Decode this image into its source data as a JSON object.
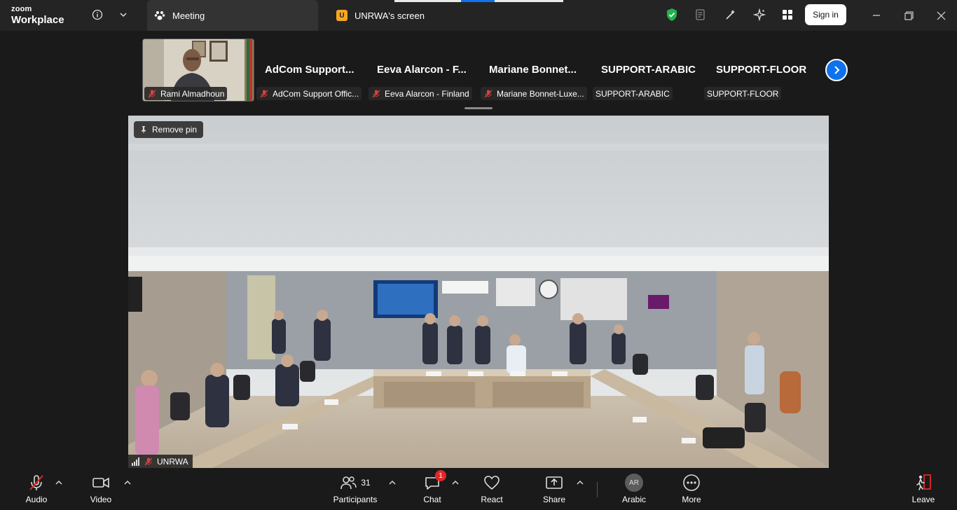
{
  "app": {
    "logo_line1": "zoom",
    "logo_line2": "Workplace"
  },
  "tabs": [
    {
      "label": "Meeting"
    },
    {
      "label": "UNRWA's screen",
      "badge_letter": "U"
    }
  ],
  "header": {
    "signin_label": "Sign in"
  },
  "participants_strip": {
    "tiles": [
      {
        "label": "Rami Almadhoun",
        "has_video": true,
        "muted": true
      },
      {
        "big_name": "AdCom  Support...",
        "label": "AdCom Support Offic...",
        "muted": true
      },
      {
        "big_name": "Eeva Alarcon - F...",
        "label": "Eeva Alarcon - Finland",
        "muted": true
      },
      {
        "big_name": "Mariane  Bonnet...",
        "label": "Mariane Bonnet-Luxe...",
        "muted": true
      },
      {
        "big_name": "SUPPORT-ARABIC",
        "label": "SUPPORT-ARABIC",
        "muted": false
      },
      {
        "big_name": "SUPPORT-FLOOR",
        "label": "SUPPORT-FLOOR",
        "muted": false
      }
    ]
  },
  "main_video": {
    "remove_pin_label": "Remove pin",
    "speaker_label": "UNRWA"
  },
  "toolbar": {
    "audio_label": "Audio",
    "video_label": "Video",
    "participants_label": "Participants",
    "participants_count": "31",
    "chat_label": "Chat",
    "chat_badge": "1",
    "react_label": "React",
    "share_label": "Share",
    "language_initials": "AR",
    "language_label": "Arabic",
    "more_label": "More",
    "leave_label": "Leave"
  },
  "colors": {
    "accent_blue": "#0e72ed",
    "leave_red": "#e02828",
    "shield_green": "#22b14c",
    "badge_orange": "#f5a623"
  }
}
